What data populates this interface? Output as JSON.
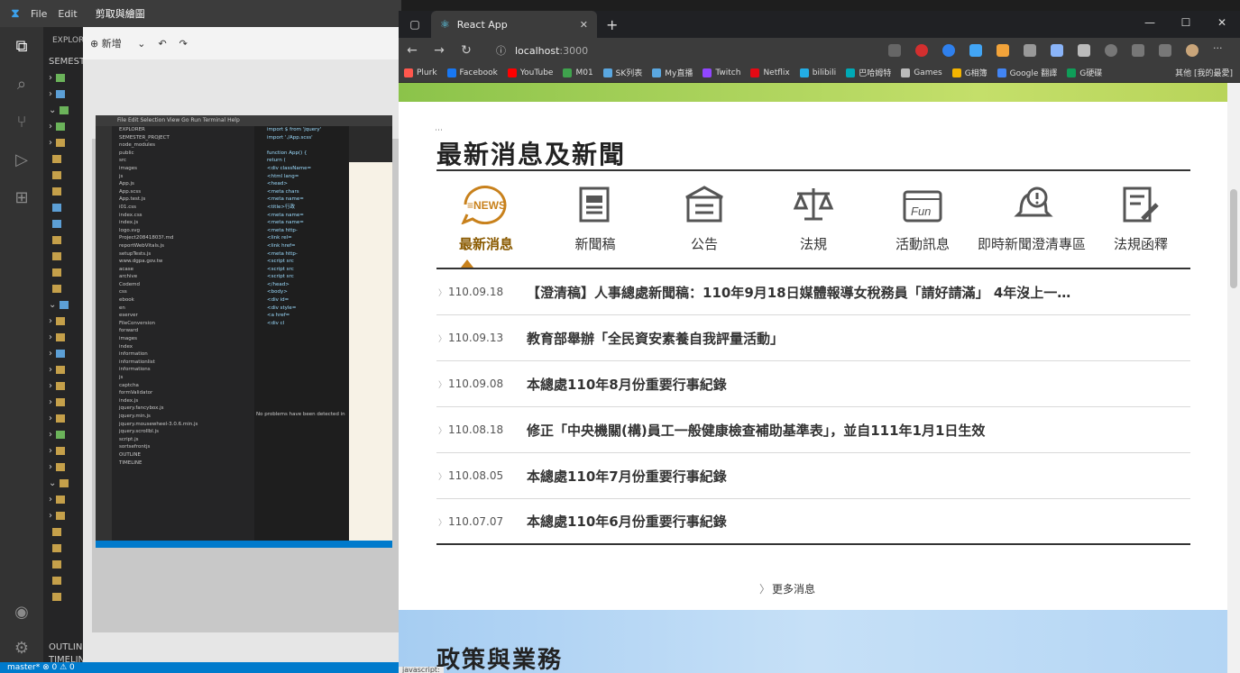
{
  "vscode": {
    "menu": [
      "File",
      "Edit"
    ],
    "snip_title": "剪取與繪圖",
    "explorer_header": "EXPLORER",
    "tree": [
      "SEMEST",
      "",
      "",
      "",
      "",
      "",
      "",
      "",
      "",
      "",
      "",
      "",
      "",
      "",
      "",
      "",
      "",
      "",
      "",
      "",
      "",
      "",
      "",
      "",
      "",
      "",
      "",
      "",
      "",
      "",
      "",
      "",
      "",
      ""
    ],
    "outline": "OUTLIN",
    "timeline": "TIMELINE",
    "status": "master*  ⊗ 0 ⚠ 0"
  },
  "snip": {
    "new_label": "新增"
  },
  "mini_vscode": {
    "title": "File  Edit  Selection  View  Go  Run  Terminal  Help",
    "explorer": "EXPLORER",
    "project": "SEMESTER_PROJECT",
    "files": [
      "node_modules",
      "public",
      "src",
      "images",
      "js",
      "App.js",
      "App.scss",
      "App.test.js",
      "i01.css",
      "index.css",
      "index.js",
      "logo.svg",
      "Project20841803?.md",
      "reportWebVitals.js",
      "setupTests.js",
      "www.dgpa.gov.tw",
      "acase",
      "archive",
      "Codemd",
      "css",
      "ebook",
      "en",
      "eserver",
      "FileConversion",
      "forward",
      "images",
      "index",
      "information",
      "informationlist",
      "informations",
      "js",
      "captcha",
      "formValidator",
      "index.js",
      "jquery.fancybox.js",
      "jquery.min.js",
      "jquery.mousewheel-3.0.6.min.js",
      "jquery.scrollbl.js",
      "script.js",
      "sortsefrontjs",
      "OUTLINE",
      "TIMELINE"
    ],
    "code": [
      "import $ from 'jquery'",
      "import './App.scss'",
      "",
      "function App() {",
      "  return (",
      "    <div className=",
      "      <html lang=",
      "      <head>",
      "        <meta chars",
      "        <meta name=",
      "        <title>行政",
      "        <meta name=",
      "        <meta name=",
      "        <meta http-",
      "        <link rel=",
      "        <link href=",
      "        <meta http-",
      "        <script src",
      "        <script src",
      "        <script src",
      "      </head>",
      "      <body>",
      "        <div id=",
      "        <div style=",
      "          <a href=",
      "            <div cl"
    ],
    "problems": "No problems have been detected in"
  },
  "browser": {
    "tab_title": "React App",
    "url_host": "localhost",
    "url_port": ":3000",
    "window_controls": [
      "—",
      "☐",
      "✕"
    ],
    "bookmarks": [
      {
        "label": "Plurk",
        "color": "#ff574d"
      },
      {
        "label": "Facebook",
        "color": "#1877f2"
      },
      {
        "label": "YouTube",
        "color": "#ff0000"
      },
      {
        "label": "M01",
        "color": "#3fa34d"
      },
      {
        "label": "SK列表",
        "color": "#5aa7e0"
      },
      {
        "label": "My直播",
        "color": "#5aa7e0"
      },
      {
        "label": "Twitch",
        "color": "#9146ff"
      },
      {
        "label": "Netflix",
        "color": "#e50914"
      },
      {
        "label": "bilibili",
        "color": "#23ade5"
      },
      {
        "label": "巴哈姆特",
        "color": "#00a9b6"
      },
      {
        "label": "Games",
        "color": "#bbbbbb"
      },
      {
        "label": "G相簿",
        "color": "#f4b400"
      },
      {
        "label": "Google 翻譯",
        "color": "#4285f4"
      },
      {
        "label": "G硬碟",
        "color": "#0f9d58"
      }
    ],
    "other_bookmarks": "其他 [我的最愛]"
  },
  "page": {
    "news_title": "最新消息及新聞",
    "categories": [
      {
        "label": "最新消息",
        "icon": "news-icon"
      },
      {
        "label": "新聞稿",
        "icon": "newspaper-icon"
      },
      {
        "label": "公告",
        "icon": "announcement-icon"
      },
      {
        "label": "法規",
        "icon": "scale-icon"
      },
      {
        "label": "活動訊息",
        "icon": "calendar-fun-icon"
      },
      {
        "label": "即時新聞澄清專區",
        "icon": "alert-bell-icon"
      },
      {
        "label": "法規函釋",
        "icon": "document-edit-icon"
      }
    ],
    "news": [
      {
        "date": "110.09.18",
        "text": "【澄清稿】人事總處新聞稿：110年9月18日媒體報導女稅務員「請好請滿」 4年沒上一…"
      },
      {
        "date": "110.09.13",
        "text": "教育部舉辦「全民資安素養自我評量活動」"
      },
      {
        "date": "110.09.08",
        "text": "本總處110年8月份重要行事紀錄"
      },
      {
        "date": "110.08.18",
        "text": "修正「中央機關(構)員工一般健康檢查補助基準表」，並自111年1月1日生效"
      },
      {
        "date": "110.08.05",
        "text": "本總處110年7月份重要行事紀錄"
      },
      {
        "date": "110.07.07",
        "text": "本總處110年6月份重要行事紀錄"
      }
    ],
    "more_news": "更多消息",
    "policy_title": "政策與業務",
    "status_text": "javascript:"
  }
}
